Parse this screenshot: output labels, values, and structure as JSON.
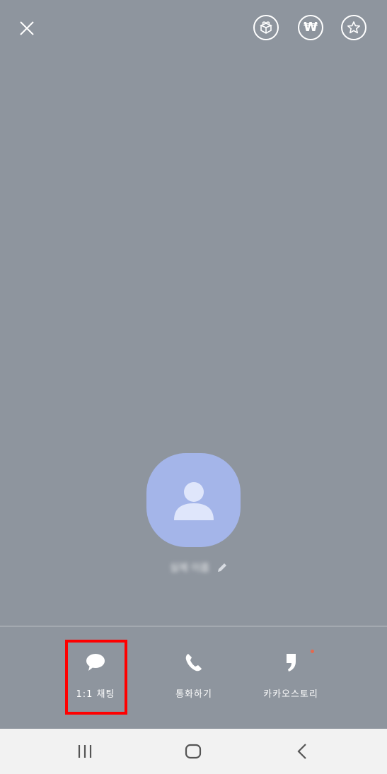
{
  "header": {
    "close_icon": "close-icon",
    "gift_icon": "gift-icon",
    "won_symbol": "₩",
    "star_icon": "star-icon"
  },
  "profile": {
    "avatar_icon": "person-icon",
    "name": "실제 이름",
    "edit_icon": "pencil-icon"
  },
  "actions": [
    {
      "label": "1:1 채팅",
      "icon": "chat-bubble-icon"
    },
    {
      "label": "통화하기",
      "icon": "phone-icon"
    },
    {
      "label": "카카오스토리",
      "icon": "kakaostory-icon"
    }
  ],
  "colors": {
    "background": "#8e959e",
    "avatar": "#a4b5e9",
    "highlight": "#ff0000",
    "notification_dot": "#e46a4f",
    "nav_bar": "#f2f2f2"
  },
  "nav": {
    "recent_icon": "recent-apps-icon",
    "home_icon": "home-icon",
    "back_icon": "back-icon"
  }
}
